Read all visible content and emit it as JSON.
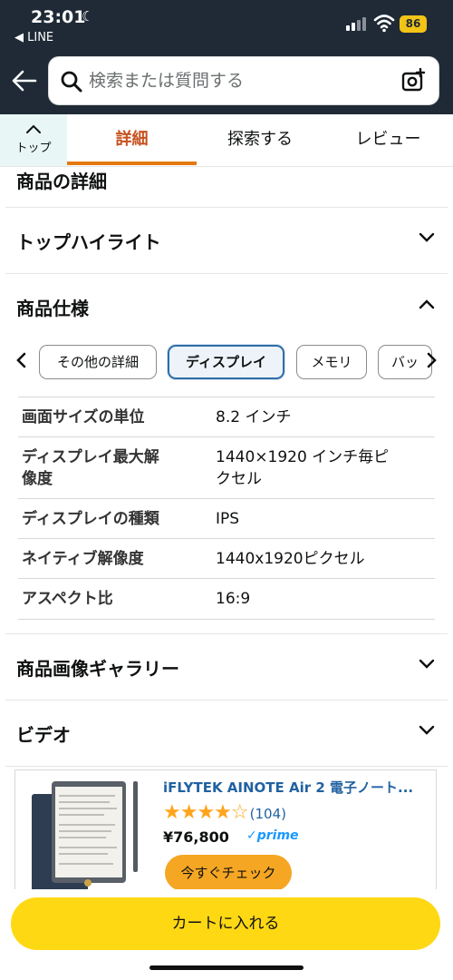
{
  "status_bar": {
    "time": "23:01",
    "back_app": "◀ LINE",
    "battery": "86"
  },
  "header": {
    "search_placeholder": "検索または質問する"
  },
  "tabs": {
    "top_label": "トップ",
    "items": [
      {
        "label": "詳細"
      },
      {
        "label": "探索する"
      },
      {
        "label": "レビュー"
      }
    ]
  },
  "details": {
    "section_title": "商品の詳細",
    "top_highlights": "トップハイライト",
    "specs_title": "商品仕様",
    "chips": [
      "その他の詳細",
      "ディスプレイ",
      "メモリ",
      "バッ"
    ],
    "spec_rows": [
      {
        "key": "画面サイズの単位",
        "value": "8.2 インチ"
      },
      {
        "key_lines": [
          "ディスプレイ最大解",
          "像度"
        ],
        "value_lines": [
          "1440×1920 インチ毎ピ",
          "クセル"
        ]
      },
      {
        "key": "ディスプレイの種類",
        "value": "IPS"
      },
      {
        "key": "ネイティブ解像度",
        "value": "1440x1920ピクセル"
      },
      {
        "key": "アスペクト比",
        "value": "16:9"
      }
    ],
    "gallery_title": "商品画像ギャラリー",
    "video_title": "ビデオ"
  },
  "ad": {
    "title": "iFLYTEK AINOTE Air 2 電子ノート...",
    "rating": 4,
    "stars": "★★★★☆",
    "review_count": "(104)",
    "price": "¥76,800",
    "prime": "✓prime",
    "cta": "今すぐチェック"
  },
  "bottom": {
    "cart_button": "カートに入れる"
  },
  "colors": {
    "header_bg": "#1f2a36",
    "tab_active": "#c7511f",
    "tab_underline": "#e47911",
    "cart_button": "#ffd814",
    "cta_button": "#f5a623",
    "link": "#2162a1",
    "chip_active_border": "#2f6ea8"
  }
}
